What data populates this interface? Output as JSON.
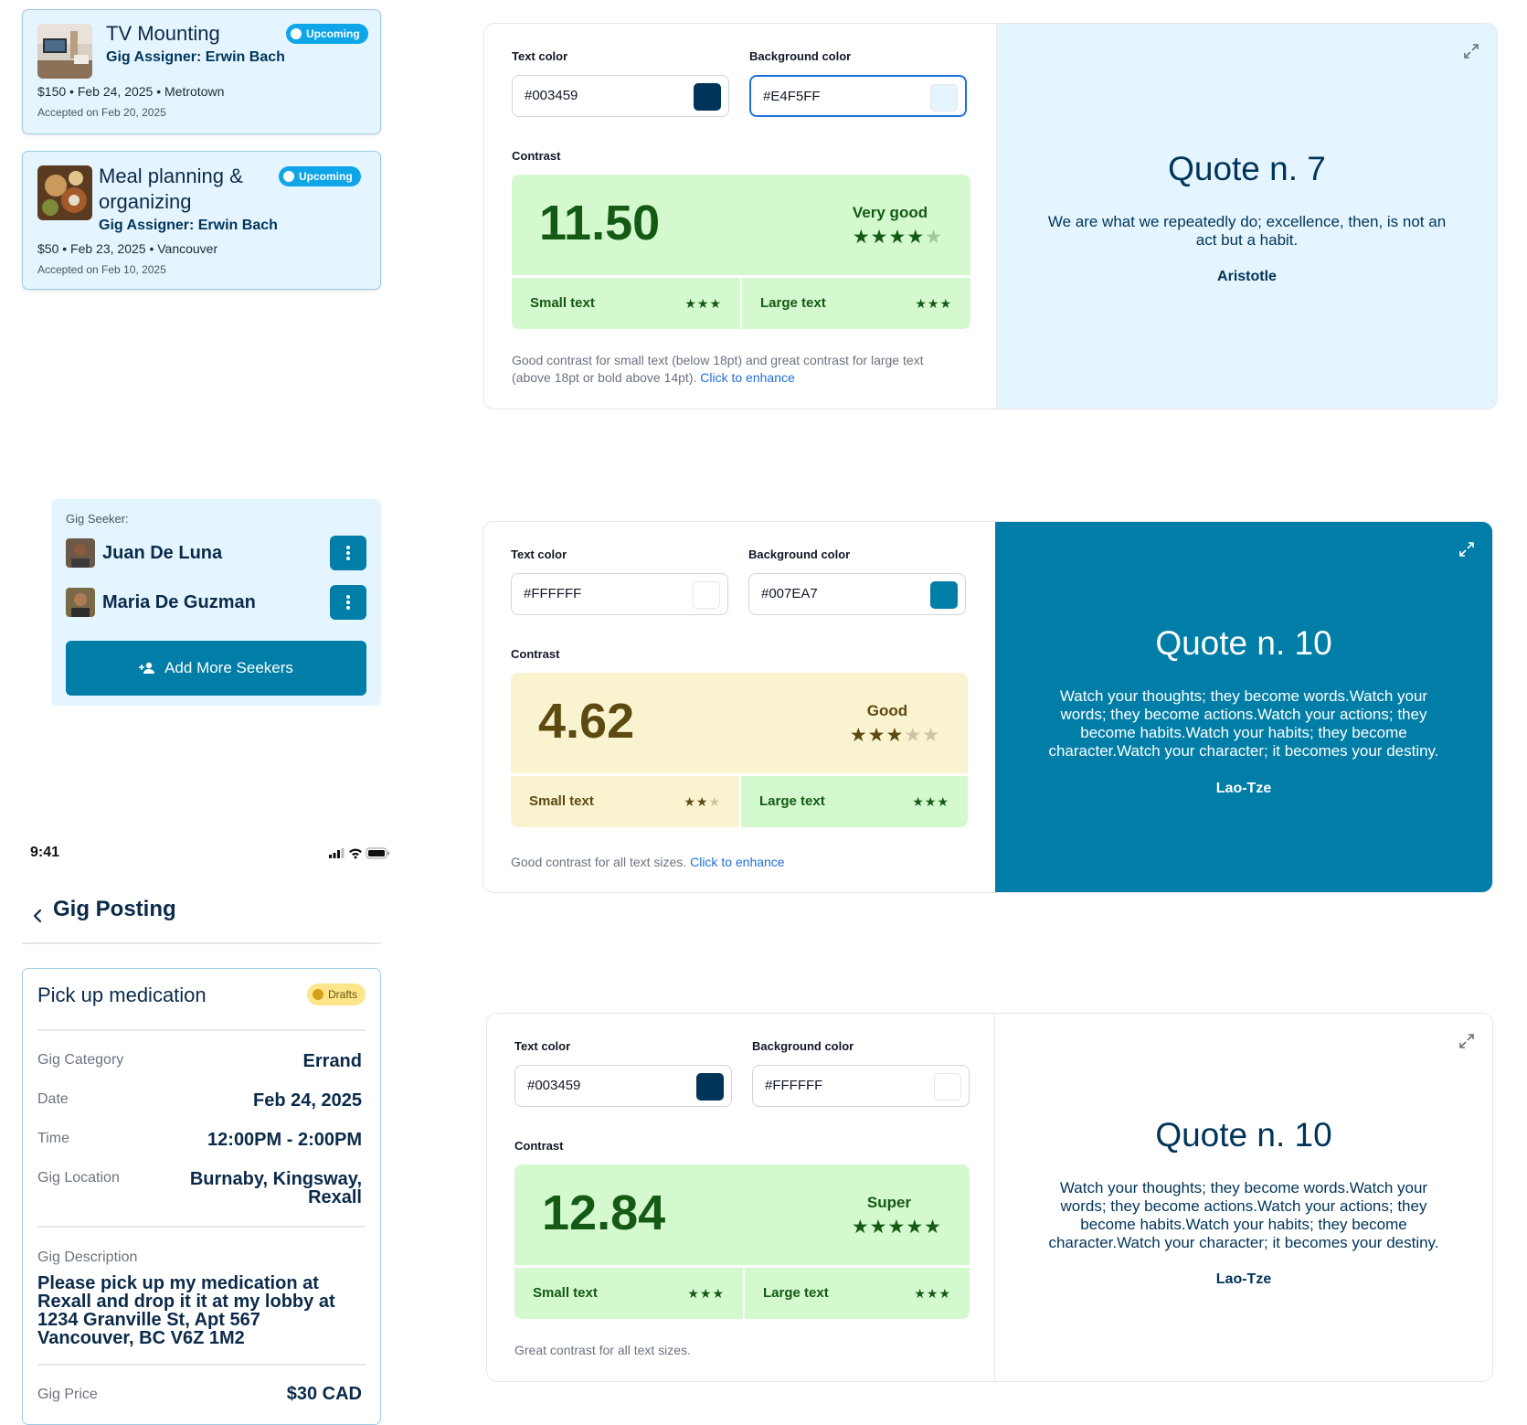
{
  "gig_cards": [
    {
      "title": "TV Mounting",
      "badge": "Upcoming",
      "assigner": "Gig Assigner: Erwin Bach",
      "meta": "$150 • Feb 24, 2025 • Metrotown",
      "accepted": "Accepted on Feb 20, 2025"
    },
    {
      "title_line1": "Meal planning &",
      "title_line2": "organizing",
      "badge": "Upcoming",
      "assigner": "Gig Assigner: Erwin Bach",
      "meta": "$50 • Feb 23, 2025 • Vancouver",
      "accepted": "Accepted on Feb 10, 2025"
    }
  ],
  "seekers": {
    "label": "Gig Seeker:",
    "items": [
      {
        "name": "Juan De Luna"
      },
      {
        "name": "Maria De Guzman"
      }
    ],
    "add_button": "Add More Seekers"
  },
  "status_bar": {
    "time": "9:41"
  },
  "gig_posting": {
    "page_title": "Gig Posting",
    "name": "Pick up medication",
    "badge": "Drafts",
    "category_label": "Gig Category",
    "category": "Errand",
    "date_label": "Date",
    "date": "Feb 24, 2025",
    "time_label": "Time",
    "time": "12:00PM - 2:00PM",
    "location_label": "Gig Location",
    "location_line1": "Burnaby, Kingsway,",
    "location_line2": "Rexall",
    "description_label": "Gig Description",
    "description": "Please pick up my medication at Rexall and drop it it at my lobby at 1234 Granville St, Apt 567 Vancouver, BC V6Z 1M2",
    "price_label": "Gig Price",
    "price": "$30 CAD"
  },
  "contrast_panels": [
    {
      "text_color_label": "Text color",
      "text_color": "#003459",
      "bg_color_label": "Background color",
      "bg_color": "#E4F5FF",
      "contrast_label": "Contrast",
      "ratio": "11.50",
      "rating": "Very good",
      "rating_stars": 4,
      "small_text": "Small text",
      "small_stars": 3,
      "large_text": "Large text",
      "large_stars": 3,
      "note": "Good contrast for small text (below 18pt) and great contrast for large text (above 18pt or bold above 14pt).",
      "link": "Click to enhance",
      "quote_title": "Quote n. 7",
      "quote_body": "We are what we repeatedly do; excellence, then, is not an act but a habit.",
      "quote_author": "Aristotle"
    },
    {
      "text_color_label": "Text color",
      "text_color": "#FFFFFF",
      "bg_color_label": "Background color",
      "bg_color": "#007EA7",
      "contrast_label": "Contrast",
      "ratio": "4.62",
      "rating": "Good",
      "rating_stars": 3,
      "small_text": "Small text",
      "small_stars": 2,
      "large_text": "Large text",
      "large_stars": 3,
      "note": "Good contrast for all text sizes.",
      "link": "Click to enhance",
      "quote_title": "Quote n. 10",
      "quote_body": "Watch your thoughts; they become words.Watch your words; they become actions.Watch your actions; they become habits.Watch your habits; they become character.Watch your character; it becomes your destiny.",
      "quote_author": "Lao-Tze"
    },
    {
      "text_color_label": "Text color",
      "text_color": "#003459",
      "bg_color_label": "Background color",
      "bg_color": "#FFFFFF",
      "contrast_label": "Contrast",
      "ratio": "12.84",
      "rating": "Super",
      "rating_stars": 5,
      "small_text": "Small text",
      "small_stars": 3,
      "large_text": "Large text",
      "large_stars": 3,
      "note": "Great contrast for all text sizes.",
      "quote_title": "Quote n. 10",
      "quote_body": "Watch your thoughts; they become words.Watch your words; they become actions.Watch your actions; they become habits.Watch your habits; they become character.Watch your character; it becomes your destiny.",
      "quote_author": "Lao-Tze"
    }
  ],
  "colors": {
    "accent": "#007EA7",
    "navy": "#003459",
    "light_blue": "#E4F5FF",
    "badge_blue": "#0EA5E9",
    "green_bg": "#D4F9CF",
    "green_text": "#145A14",
    "yellow_bg": "#FAF3D0",
    "yellow_text": "#5C4A10"
  },
  "icons": [
    "expand-icon",
    "kebab-icon",
    "add-user-icon",
    "back-chevron-icon",
    "signal-icon",
    "wifi-icon",
    "battery-icon",
    "star-icon"
  ]
}
